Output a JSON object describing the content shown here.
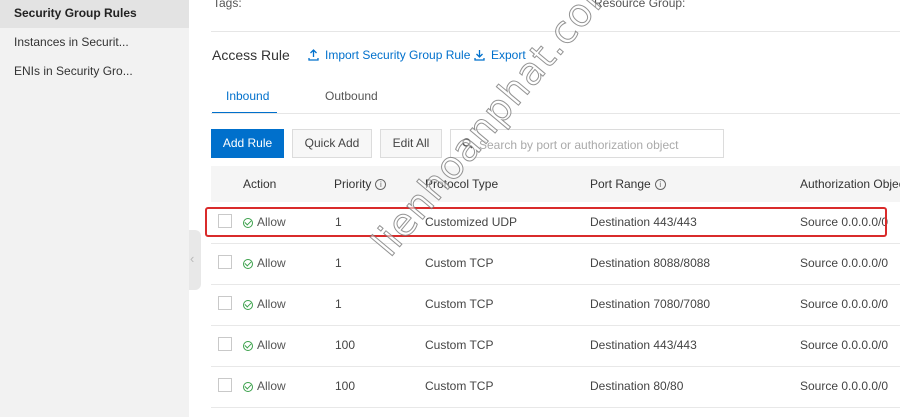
{
  "sidebar": {
    "items": [
      {
        "label": "Security Group Rules",
        "active": true
      },
      {
        "label": "Instances in Securit..."
      },
      {
        "label": "ENIs in Security Gro..."
      }
    ]
  },
  "info": {
    "tags_label": "Tags:",
    "resource_group_label": "Resource Group:"
  },
  "access_rule": {
    "title": "Access Rule",
    "import_label": "Import Security Group Rule",
    "export_label": "Export"
  },
  "tabs": {
    "inbound": "Inbound",
    "outbound": "Outbound",
    "active": "Inbound"
  },
  "toolbar": {
    "add_rule": "Add Rule",
    "quick_add": "Quick Add",
    "edit_all": "Edit All",
    "search_placeholder": "Search by port or authorization object"
  },
  "table": {
    "columns": [
      "Action",
      "Priority",
      "Protocol Type",
      "Port Range",
      "Authorization Object"
    ],
    "rows": [
      {
        "action": "Allow",
        "priority": "1",
        "protocol": "Customized UDP",
        "port": "Destination 443/443",
        "auth": "Source 0.0.0.0/0"
      },
      {
        "action": "Allow",
        "priority": "1",
        "protocol": "Custom TCP",
        "port": "Destination 8088/8088",
        "auth": "Source 0.0.0.0/0"
      },
      {
        "action": "Allow",
        "priority": "1",
        "protocol": "Custom TCP",
        "port": "Destination 7080/7080",
        "auth": "Source 0.0.0.0/0"
      },
      {
        "action": "Allow",
        "priority": "100",
        "protocol": "Custom TCP",
        "port": "Destination 443/443",
        "auth": "Source 0.0.0.0/0"
      },
      {
        "action": "Allow",
        "priority": "100",
        "protocol": "Custom TCP",
        "port": "Destination 80/80",
        "auth": "Source 0.0.0.0/0"
      }
    ]
  },
  "watermark": "lienhoanphat.com",
  "colors": {
    "accent": "#0070cc",
    "allow": "#3aa04a",
    "highlight": "#d92b2b"
  }
}
